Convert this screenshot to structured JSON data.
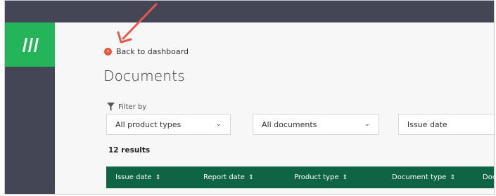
{
  "brand": {
    "logo_icon": "bars-logo-icon",
    "color": "#24b45a"
  },
  "nav": {
    "back_label": "Back to dashboard",
    "back_icon": "chevron-left-circle-icon"
  },
  "page": {
    "title": "Documents"
  },
  "filters": {
    "label": "Filter by",
    "icon": "funnel-icon",
    "product_type": "All product types",
    "documents": "All documents",
    "issue_date_placeholder": "Issue date"
  },
  "results": {
    "count_label": "12 results"
  },
  "table": {
    "headers": [
      "Issue date",
      "Report date",
      "Product type",
      "Document type",
      "Doc"
    ]
  },
  "colors": {
    "header_bg": "#106446",
    "accent": "#e8573f",
    "chrome": "#454655"
  }
}
